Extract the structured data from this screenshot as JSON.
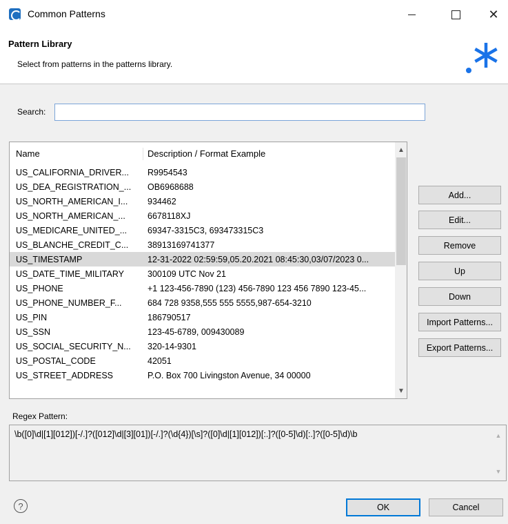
{
  "window": {
    "title": "Common Patterns"
  },
  "banner": {
    "title": "Pattern Library",
    "subtitle": "Select from patterns in the patterns library."
  },
  "search": {
    "label": "Search:",
    "value": ""
  },
  "table": {
    "columns": [
      "Name",
      "Description / Format Example"
    ],
    "rows": [
      {
        "name": "US_CALIFORNIA_DRIVER...",
        "desc": "R9954543"
      },
      {
        "name": "US_DEA_REGISTRATION_...",
        "desc": "OB6968688"
      },
      {
        "name": "US_NORTH_AMERICAN_I...",
        "desc": "934462"
      },
      {
        "name": "US_NORTH_AMERICAN_...",
        "desc": "6678118XJ"
      },
      {
        "name": "US_MEDICARE_UNITED_...",
        "desc": "69347-3315C3, 693473315C3"
      },
      {
        "name": "US_BLANCHE_CREDIT_C...",
        "desc": "38913169741377"
      },
      {
        "name": "US_TIMESTAMP",
        "desc": "12-31-2022 02:59:59,05.20.2021 08:45:30,03/07/2023 0..."
      },
      {
        "name": "US_DATE_TIME_MILITARY",
        "desc": "300109 UTC Nov 21"
      },
      {
        "name": "US_PHONE",
        "desc": "+1 123-456-7890 (123) 456-7890 123 456 7890 123-45..."
      },
      {
        "name": "US_PHONE_NUMBER_F...",
        "desc": "684 728 9358,555 555 5555,987-654-3210"
      },
      {
        "name": "US_PIN",
        "desc": "186790517"
      },
      {
        "name": "US_SSN",
        "desc": "123-45-6789, 009430089"
      },
      {
        "name": "US_SOCIAL_SECURITY_N...",
        "desc": "320-14-9301"
      },
      {
        "name": "US_POSTAL_CODE",
        "desc": "42051"
      },
      {
        "name": "US_STREET_ADDRESS",
        "desc": "P.O. Box 700 Livingston Avenue, 34 00000"
      }
    ],
    "selected_index": 6
  },
  "buttons": {
    "add": "Add...",
    "edit": "Edit...",
    "remove": "Remove",
    "up": "Up",
    "down": "Down",
    "import": "Import Patterns...",
    "export": "Export Patterns..."
  },
  "regex": {
    "label": "Regex Pattern:",
    "value": "\\b([0]\\d|[1][012])[-/.]?([012]\\d|[3][01])[-/.]?(\\d{4})[\\s]?([0]\\d|[1][012])[:.]?([0-5]\\d)[:.]?([0-5]\\d)\\b"
  },
  "footer": {
    "help": "?",
    "ok": "OK",
    "cancel": "Cancel"
  }
}
